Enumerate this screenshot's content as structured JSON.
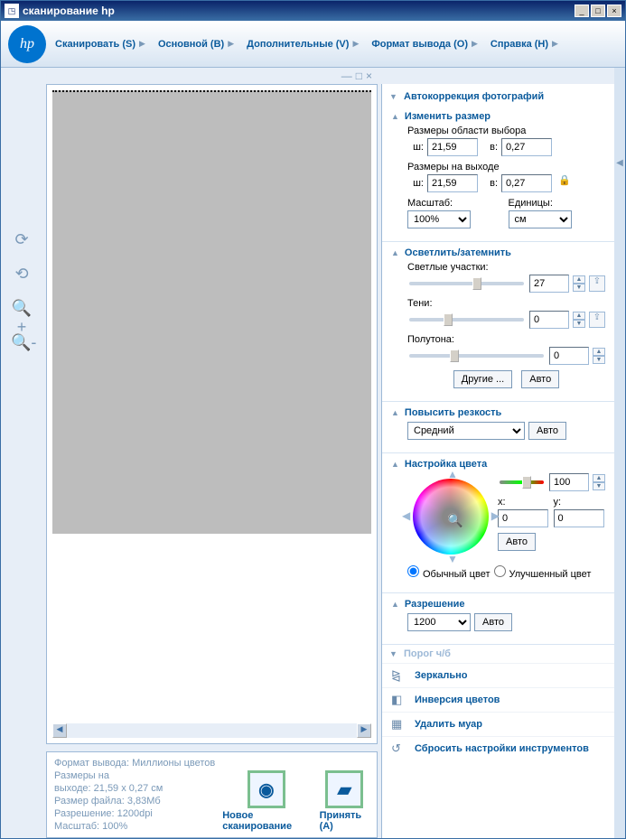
{
  "window": {
    "title": "сканирование hp"
  },
  "menu": {
    "scan": "Сканировать (S)",
    "basic": "Основной (B)",
    "advanced": "Дополнительные (V)",
    "output": "Формат вывода (O)",
    "help": "Справка (H)"
  },
  "sections": {
    "autocorrect": "Автокоррекция фотографий",
    "resize": "Изменить размер",
    "lighten": "Осветлить/затемнить",
    "sharpen": "Повысить резкость",
    "color": "Настройка цвета",
    "resolution": "Разрешение",
    "threshold": "Порог ч/б",
    "mirror": "Зеркально",
    "invert": "Инверсия цветов",
    "descreen": "Удалить муар",
    "reset": "Сбросить настройки инструментов"
  },
  "resize": {
    "selection_label": "Размеры области выбора",
    "output_label": "Размеры на выходе",
    "w_label": "ш:",
    "h_label": "в:",
    "w": "21,59",
    "h": "0,27",
    "w2": "21,59",
    "h2": "0,27",
    "scale_label": "Масштаб:",
    "scale_value": "100%",
    "units_label": "Единицы:",
    "units_value": "см"
  },
  "lighten": {
    "highlights": "Светлые участки:",
    "highlights_val": "27",
    "shadows": "Тени:",
    "shadows_val": "0",
    "midtones": "Полутона:",
    "midtones_val": "0",
    "other_btn": "Другие ...",
    "auto_btn": "Авто"
  },
  "sharpen": {
    "value": "Средний",
    "auto": "Авто"
  },
  "color": {
    "sat_val": "100",
    "x_label": "x:",
    "x_val": "0",
    "y_label": "y:",
    "y_val": "0",
    "auto": "Авто",
    "normal": "Обычный цвет",
    "enhanced": "Улучшенный цвет"
  },
  "resolution": {
    "value": "1200",
    "auto": "Авто"
  },
  "status": {
    "format": "Формат вывода: Миллионы цветов",
    "dims_lbl": "Размеры на",
    "dims": "выходе: 21,59 x 0,27 см",
    "size": "Размер файла: 3,83Мб",
    "res": "Разрешение: 1200dpi",
    "scale": "Масштаб: 100%",
    "newscan": "Новое сканирование",
    "accept": "Принять (A)"
  }
}
